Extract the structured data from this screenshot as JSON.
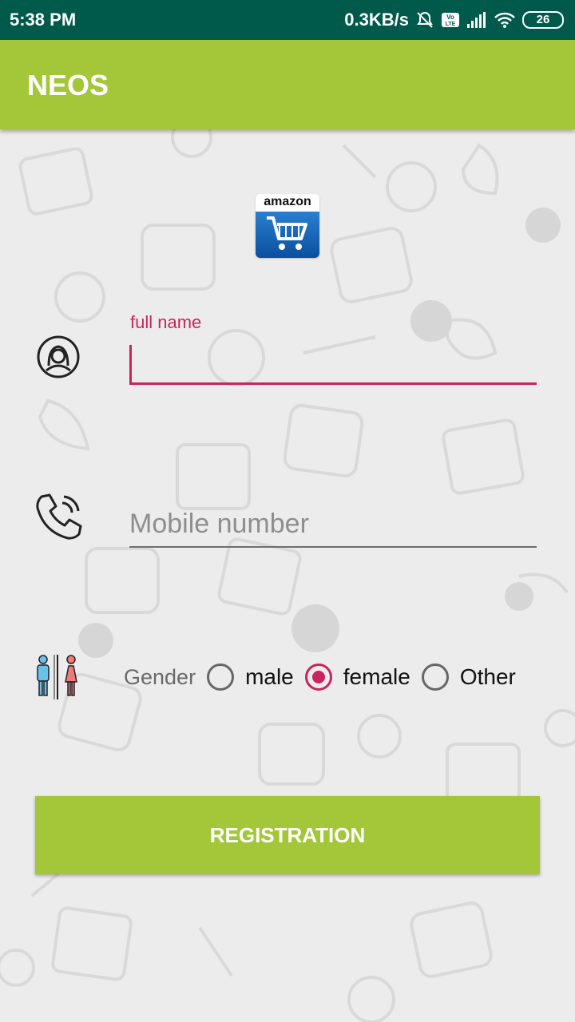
{
  "status_bar": {
    "time": "5:38 PM",
    "network_speed": "0.3KB/s",
    "battery": "26",
    "icons": [
      "mute-icon",
      "volte-icon",
      "signal-icon",
      "wifi-icon",
      "battery-icon"
    ]
  },
  "app_bar": {
    "title": "NEOS"
  },
  "logo": {
    "text": "amazon",
    "icon": "shopping-cart-icon"
  },
  "form": {
    "full_name": {
      "label": "full name",
      "value": "",
      "icon": "person-icon"
    },
    "mobile": {
      "placeholder": "Mobile number",
      "value": "",
      "icon": "phone-icon"
    },
    "gender": {
      "label": "Gender",
      "icon": "restroom-icon",
      "options": [
        {
          "label": "male",
          "checked": false
        },
        {
          "label": "female",
          "checked": true
        },
        {
          "label": "Other",
          "checked": false
        }
      ]
    },
    "submit_label": "REGISTRATION"
  },
  "colors": {
    "status_bar": "#005a4c",
    "app_bar": "#a4c739",
    "accent": "#c8255e",
    "button": "#a4c739"
  }
}
